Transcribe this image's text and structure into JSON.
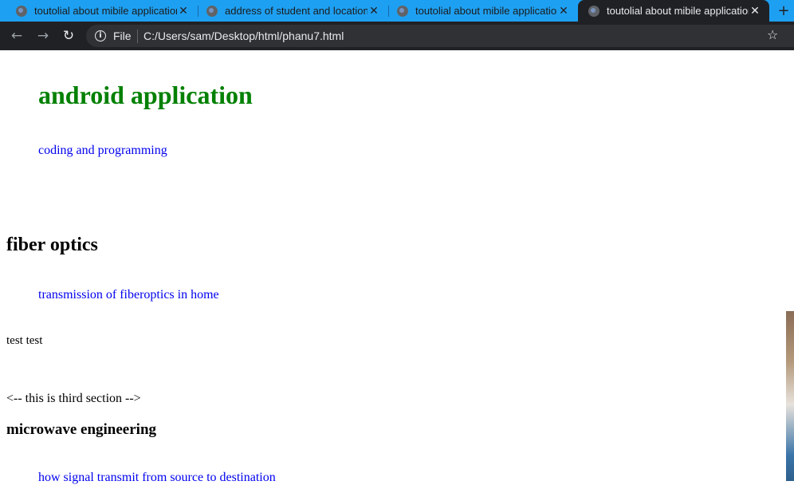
{
  "browser": {
    "tabs": [
      {
        "title": "toutolial about mibile application",
        "active": false
      },
      {
        "title": "address of student and location",
        "active": false
      },
      {
        "title": "toutolial about mibile application",
        "active": false
      },
      {
        "title": "toutolial about mibile application",
        "active": true
      }
    ],
    "new_tab_symbol": "+",
    "close_symbol": "✕",
    "address": {
      "scheme_label": "File",
      "url": "C:/Users/sam/Desktop/html/phanu7.html"
    }
  },
  "page": {
    "heading": "android application",
    "heading_color": "#008000",
    "link1": "coding and programming",
    "section2_heading": "fiber optics",
    "link2": "transmission of fiberoptics in home",
    "test_text": "test test",
    "comment_text": "<-- this is third section -->",
    "section3_heading": "microwave engineering",
    "link3": "how signal transmit from source to destination"
  },
  "colors": {
    "tab_strip": "#1ea0f2",
    "toolbar": "#202124",
    "link": "#0000ee"
  }
}
